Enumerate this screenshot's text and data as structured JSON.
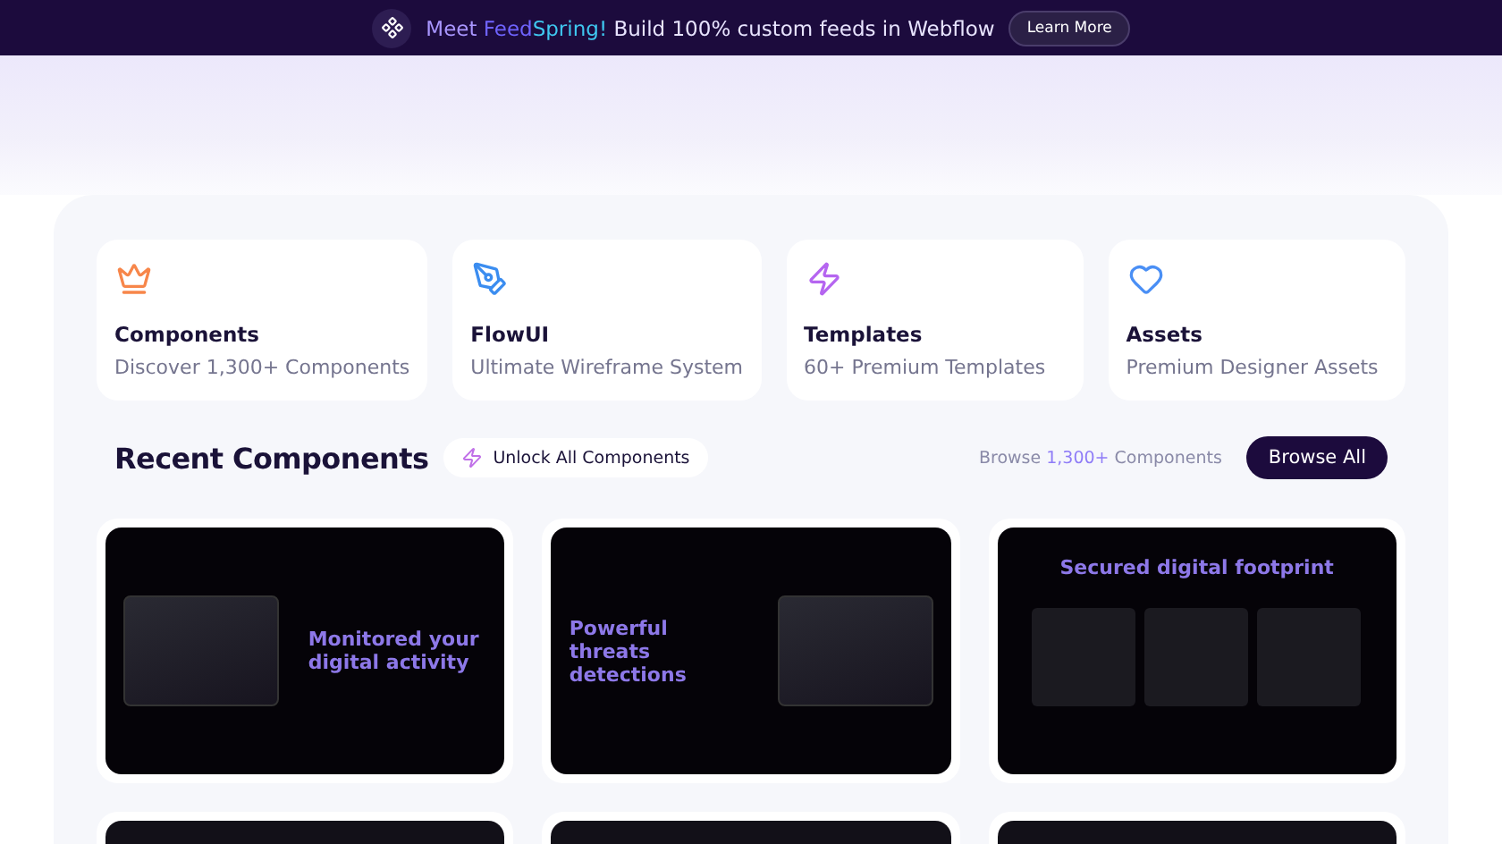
{
  "banner": {
    "message": [
      {
        "text": "Meet ",
        "color": "#a996ff"
      },
      {
        "text": "Feed",
        "color": "#6f63ff"
      },
      {
        "text": "Spring!",
        "color": "#3fc8f0"
      },
      {
        "text": " Build 100% custom feeds in Webflow",
        "color": "#e8e4ff"
      }
    ],
    "button": "Learn More"
  },
  "categories": [
    {
      "title": "Components",
      "subtitle": "Discover 1,300+ Components"
    },
    {
      "title": "FlowUI",
      "subtitle": "Ultimate Wireframe System"
    },
    {
      "title": "Templates",
      "subtitle": "60+ Premium Templates"
    },
    {
      "title": "Assets",
      "subtitle": "Premium Designer Assets"
    }
  ],
  "recent": {
    "title": "Recent Components",
    "unlock_button": "Unlock All Components",
    "browse_text": [
      {
        "text": "Browse ",
        "color": "#8a8aa8"
      },
      {
        "text": "1,300+",
        "color": "#8f7cf7"
      },
      {
        "text": " Components",
        "color": "#8a8aa8"
      }
    ],
    "browse_button": "Browse All"
  },
  "previews": [
    {
      "kind": "right",
      "headline": "Monitored your digital activity"
    },
    {
      "kind": "left",
      "headline": "Powerful threats detections"
    },
    {
      "kind": "centered",
      "headline": "Secured digital footprint"
    }
  ]
}
